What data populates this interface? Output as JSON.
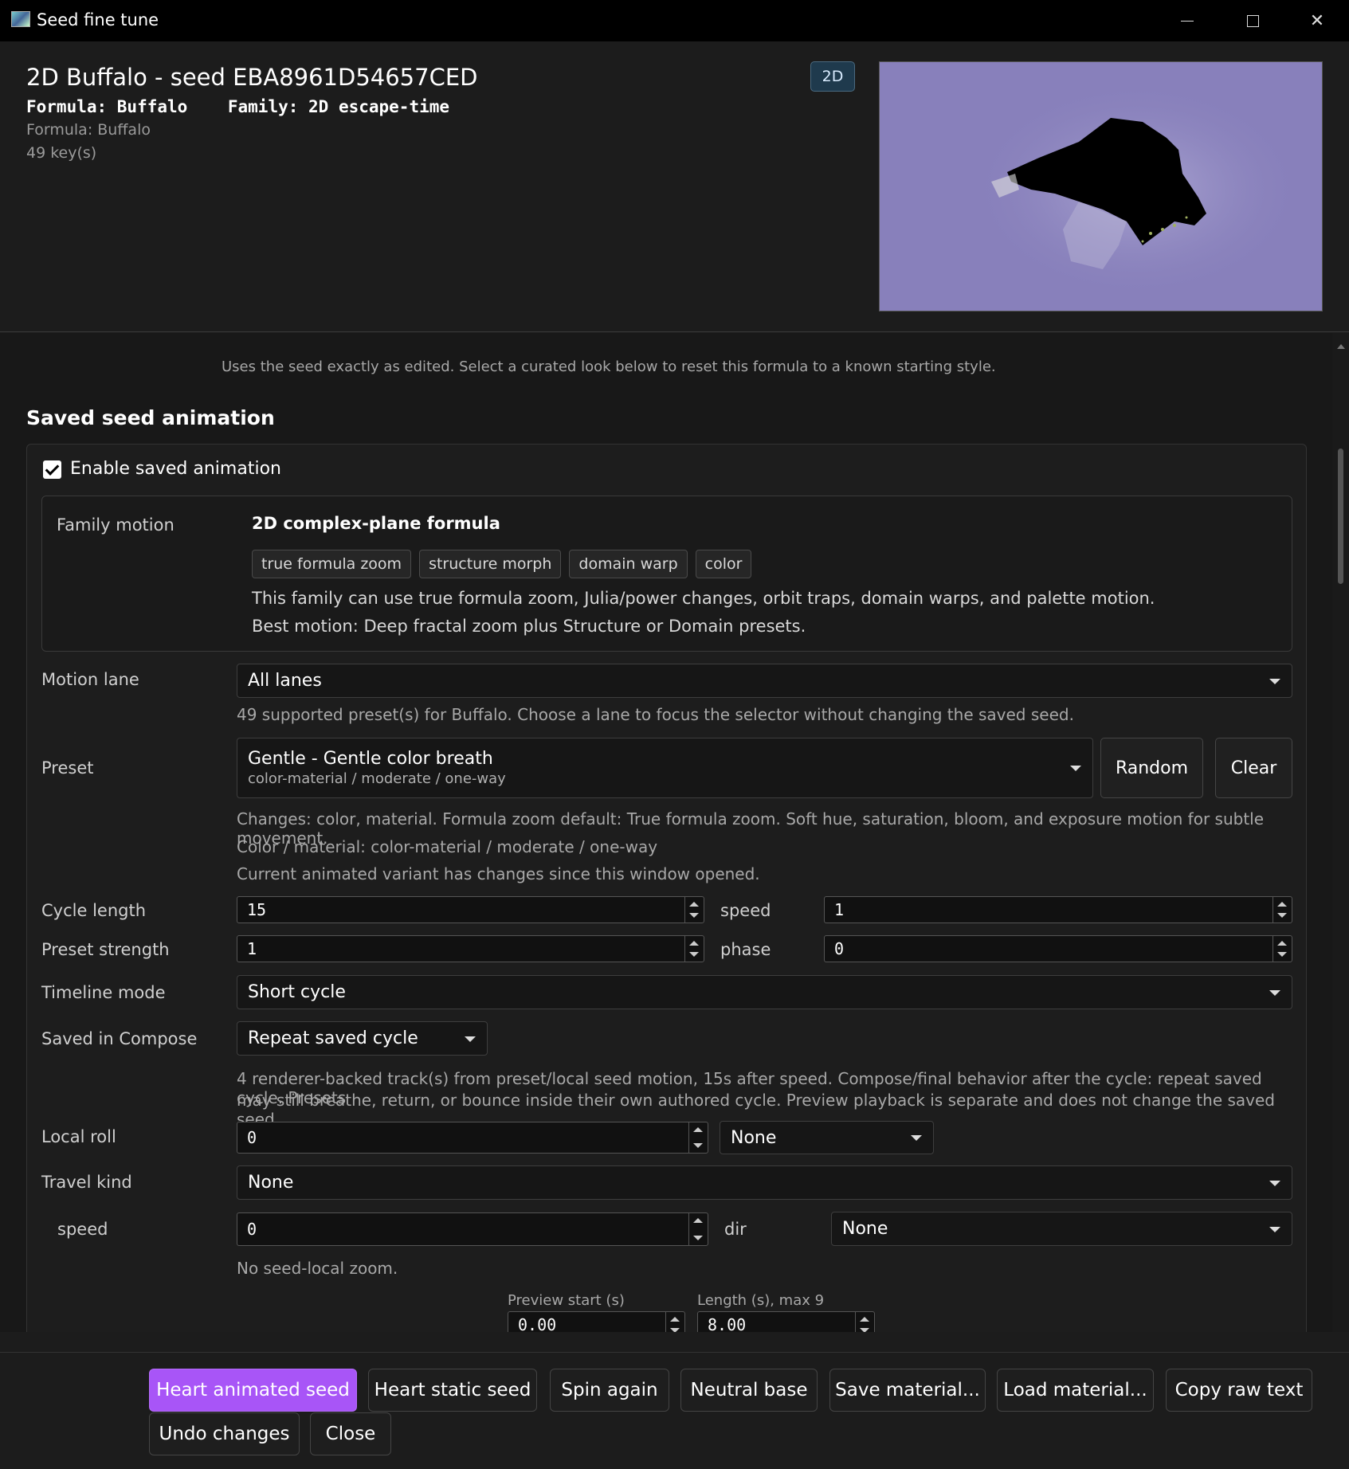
{
  "window": {
    "title": "Seed fine tune"
  },
  "header": {
    "seed_title": "2D Buffalo - seed EBA8961D54657CED",
    "formula_label": "Formula: Buffalo",
    "family_label": "Family: 2D escape-time",
    "formula_sub": "Formula: Buffalo",
    "keys_count": "49 key(s)",
    "badge": "2D"
  },
  "main": {
    "hint": "Uses the seed exactly as edited. Select a curated look below to reset this formula to a known starting style.",
    "section_title": "Saved seed animation",
    "enable_label": "Enable saved animation",
    "family_motion": {
      "label": "Family motion",
      "heading": "2D complex-plane formula",
      "chips": [
        "true formula zoom",
        "structure morph",
        "domain warp",
        "color"
      ],
      "desc1": "This family can use true formula zoom, Julia/power changes, orbit traps, domain warps, and palette motion.",
      "desc2": "Best motion: Deep fractal zoom plus Structure or Domain presets."
    },
    "motion_lane": {
      "label": "Motion lane",
      "value": "All lanes",
      "note": "49 supported preset(s) for Buffalo. Choose a lane to focus the selector without changing the saved seed."
    },
    "preset": {
      "label": "Preset",
      "value": "Gentle - Gentle color breath",
      "sub": "color-material / moderate / one-way",
      "random_label": "Random",
      "clear_label": "Clear",
      "note1": "Changes: color, material. Formula zoom default: True formula zoom. Soft hue, saturation, bloom, and exposure motion for subtle movement.",
      "note2": "Color / material: color-material / moderate / one-way",
      "note3": "Current animated variant has changes since this window opened."
    },
    "cycle_length": {
      "label": "Cycle length",
      "value": "15"
    },
    "speed": {
      "label": "speed",
      "value": "1"
    },
    "preset_strength": {
      "label": "Preset strength",
      "value": "1"
    },
    "phase": {
      "label": "phase",
      "value": "0"
    },
    "timeline_mode": {
      "label": "Timeline mode",
      "value": "Short cycle"
    },
    "saved_in_compose": {
      "label": "Saved in Compose",
      "value": "Repeat saved cycle",
      "note1": "4 renderer-backed track(s) from preset/local seed motion, 15s after speed. Compose/final behavior after the cycle: repeat saved cycle. Presets",
      "note2": "may still breathe, return, or bounce inside their own authored cycle. Preview playback is separate and does not change the saved seed."
    },
    "local_roll": {
      "label": "Local roll",
      "value": "0",
      "mode": "None"
    },
    "travel_kind": {
      "label": "Travel kind",
      "value": "None"
    },
    "travel_speed": {
      "label": "speed",
      "value": "0",
      "dir_label": "dir",
      "dir_value": "None",
      "note": "No seed-local zoom."
    },
    "preview_start": {
      "label": "Preview start (s)",
      "value": "0.00"
    },
    "preview_length": {
      "label": "Length (s), max 9",
      "value": "8.00"
    }
  },
  "footer": {
    "heart_animated": "Heart animated seed",
    "heart_static": "Heart static seed",
    "spin_again": "Spin again",
    "neutral_base": "Neutral base",
    "save_material": "Save material...",
    "load_material": "Load material...",
    "copy_raw": "Copy raw text",
    "undo": "Undo changes",
    "close": "Close"
  },
  "colors": {
    "accent": "#a855f7",
    "preview_bg": "#8a84be"
  }
}
